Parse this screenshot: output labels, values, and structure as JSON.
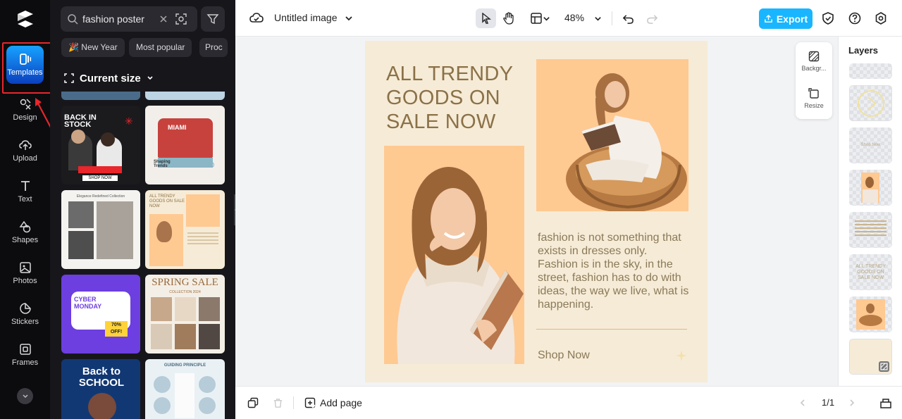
{
  "rail": {
    "items": [
      {
        "label": "Templates",
        "icon": "templates-icon"
      },
      {
        "label": "Design",
        "icon": "design-icon"
      },
      {
        "label": "Upload",
        "icon": "upload-icon"
      },
      {
        "label": "Text",
        "icon": "text-icon"
      },
      {
        "label": "Shapes",
        "icon": "shapes-icon"
      },
      {
        "label": "Photos",
        "icon": "photos-icon"
      },
      {
        "label": "Stickers",
        "icon": "stickers-icon"
      },
      {
        "label": "Frames",
        "icon": "frames-icon"
      }
    ]
  },
  "panel": {
    "search_value": "fashion poster",
    "chips": [
      "🎉 New Year",
      "Most popular",
      "Proc"
    ],
    "size_label": "Current size",
    "thumb_texts": {
      "back_in_stock": "BACK IN STOCK",
      "shop_now": "SHOP NOW",
      "miami": "MIAMI",
      "shaping_trends": "Shaping Trends",
      "elegance": "Elegance Redefined Collection",
      "all_trendy_small": "ALL TRENDY GOODS ON SALE NOW",
      "cyber_monday": "CYBER MONDAY",
      "off": "70% OFF!",
      "spring_sale": "SPRING SALE",
      "collection": "COLLECTION 2024",
      "back_to_school": "Back to SCHOOL",
      "guiding": "GUIDING PRINCIPLE"
    }
  },
  "topbar": {
    "title": "Untitled image",
    "zoom": "48%",
    "export_label": "Export"
  },
  "canvas": {
    "headline": "ALL TRENDY GOODS ON SALE NOW",
    "body": "fashion is not something that exists in dresses only. Fashion is in the sky, in the street, fashion has to do with ideas, the way we live, what is happening.",
    "cta": "Shop Now"
  },
  "float_panel": {
    "background_label": "Backgr...",
    "resize_label": "Resize"
  },
  "bottombar": {
    "add_page_label": "Add page",
    "page_indicator": "1/1"
  },
  "layers": {
    "title": "Layers",
    "items": [
      "",
      "",
      "Shop Now",
      "",
      "",
      "ALL TRENDY GOODS ON SALE NOW",
      "",
      ""
    ]
  },
  "colors": {
    "accent": "#19b6ff",
    "artboard_bg": "#f6ebd6",
    "photo_bg": "#ffc992",
    "headline": "#8a7148",
    "annotation": "#e8262b"
  }
}
